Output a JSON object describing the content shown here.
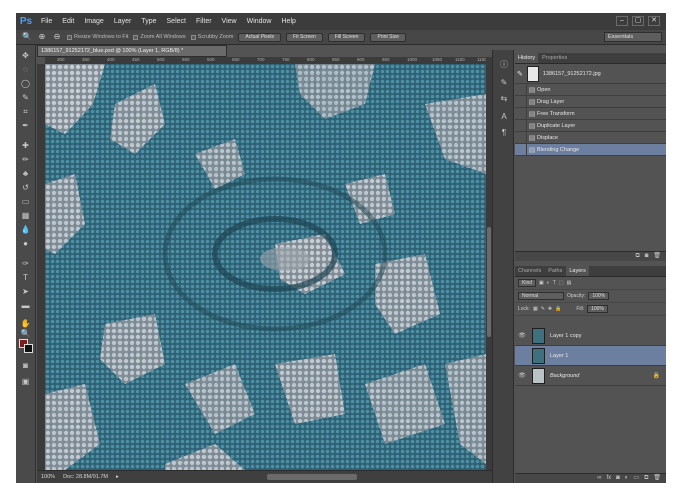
{
  "app": {
    "logo": "Ps"
  },
  "menu": [
    "File",
    "Edit",
    "Image",
    "Layer",
    "Type",
    "Select",
    "Filter",
    "View",
    "Window",
    "Help"
  ],
  "window_controls": [
    "–",
    "▢",
    "✕"
  ],
  "options_bar": {
    "resize_windows_label": "Resize Windows to Fit",
    "zoom_all_label": "Zoom All Windows",
    "scrubby_label": "Scrubby Zoom",
    "buttons": [
      "Actual Pixels",
      "Fit Screen",
      "Fill Screen",
      "Print Size"
    ],
    "workspace": "Essentials"
  },
  "document": {
    "tab_title": "1386157_91252172_blue.psd @ 100% (Layer 1, RGB/8) *",
    "ruler_ticks": [
      "300",
      "350",
      "400",
      "450",
      "500",
      "550",
      "600",
      "650",
      "700",
      "750",
      "800",
      "850",
      "900",
      "950",
      "1000",
      "1050",
      "1100",
      "1150"
    ],
    "zoom": "100%",
    "doc_info": "Doc: 28.8M/91.7M"
  },
  "history": {
    "tabs": [
      "History",
      "Properties"
    ],
    "snapshot": "1386157_91252172.jpg",
    "items": [
      "Open",
      "Drag Layer",
      "Free Transform",
      "Duplicate Layer",
      "Displace",
      "Blending Change"
    ],
    "selected_index": 5
  },
  "layers": {
    "tabs": [
      "Channels",
      "Paths",
      "Layers"
    ],
    "kind": "Kind",
    "blend_mode": "Normal",
    "opacity_label": "Opacity:",
    "opacity_value": "100%",
    "lock_label": "Lock:",
    "fill_label": "Fill:",
    "fill_value": "100%",
    "items": [
      {
        "name": "Layer 1 copy",
        "visible": true,
        "selected": false
      },
      {
        "name": "Layer 1",
        "visible": false,
        "selected": true
      },
      {
        "name": "Background",
        "visible": true,
        "selected": false,
        "locked": true
      }
    ]
  },
  "colors": {
    "foreground": "#7a1c1c",
    "background": "#111111",
    "selection": "#6d7fa0",
    "logo": "#3fa3ff"
  }
}
